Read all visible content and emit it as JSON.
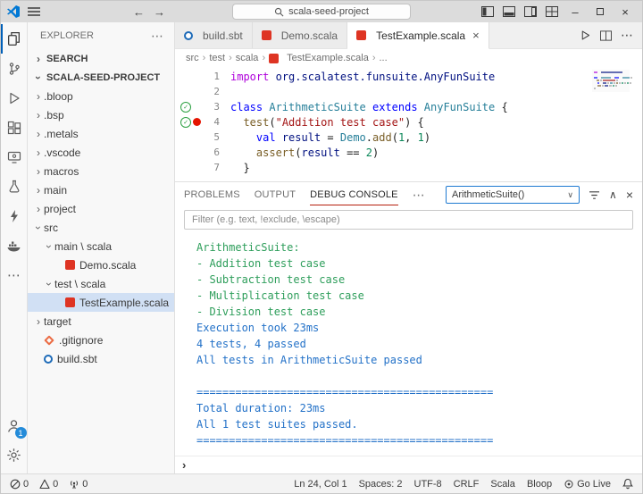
{
  "icons": {
    "more": "⋯",
    "close": "×",
    "check": "✓",
    "prompt": "›",
    "chevron": "›",
    "back": "←",
    "forward": "→",
    "chevron_down": "∨",
    "chevron_up": "∧",
    "minimize": "–"
  },
  "colors": {
    "accent_blue": "#005fb8",
    "console_green": "#2e9e5b",
    "console_blue": "#2472c8",
    "panel_active_underline": "#b5200d",
    "breakpoint_red": "#e51400",
    "test_pass_green": "#2da042",
    "scala_red": "#de3423",
    "keyword_purple": "#af00db",
    "keyword_blue": "#0000ff",
    "type_teal": "#267f99",
    "function_brown": "#795e26",
    "string_red": "#a31515",
    "number_green": "#098658"
  },
  "titlebar": {
    "search_value": "scala-seed-project"
  },
  "activity_bar": {
    "account_badge": "1"
  },
  "sidebar": {
    "header": "EXPLORER",
    "search_section": "SEARCH",
    "project_section": "SCALA-SEED-PROJECT",
    "tree": [
      {
        "label": ".bloop",
        "chevron": "right",
        "indent": 0
      },
      {
        "label": ".bsp",
        "chevron": "right",
        "indent": 0
      },
      {
        "label": ".metals",
        "chevron": "right",
        "indent": 0
      },
      {
        "label": ".vscode",
        "chevron": "right",
        "indent": 0
      },
      {
        "label": "macros",
        "chevron": "right",
        "indent": 0
      },
      {
        "label": "main",
        "chevron": "right",
        "indent": 0
      },
      {
        "label": "project",
        "chevron": "right",
        "indent": 0
      },
      {
        "label": "src",
        "chevron": "down",
        "indent": 0
      },
      {
        "label": "main \\ scala",
        "chevron": "down",
        "indent": 1
      },
      {
        "label": "Demo.scala",
        "icon": "scala",
        "indent": 2
      },
      {
        "label": "test \\ scala",
        "chevron": "down",
        "indent": 1
      },
      {
        "label": "TestExample.scala",
        "icon": "scala",
        "indent": 2,
        "selected": true
      },
      {
        "label": "target",
        "chevron": "right",
        "indent": 0
      },
      {
        "label": ".gitignore",
        "icon": "git",
        "indent": 0
      },
      {
        "label": "build.sbt",
        "icon": "sbt",
        "indent": 0
      }
    ]
  },
  "editor": {
    "tabs": [
      {
        "label": "build.sbt",
        "icon": "sbt"
      },
      {
        "label": "Demo.scala",
        "icon": "scala"
      },
      {
        "label": "TestExample.scala",
        "icon": "scala",
        "active": true
      }
    ],
    "breadcrumb": [
      "src",
      "test",
      "scala",
      "TestExample.scala",
      "..."
    ],
    "lines": [
      {
        "num": "1",
        "tokens": [
          {
            "t": "import",
            "c": "kw1"
          },
          {
            "t": " ",
            "c": "plain"
          },
          {
            "t": "org.scalatest.funsuite.AnyFunSuite",
            "c": "ns"
          }
        ]
      },
      {
        "num": "2",
        "tokens": []
      },
      {
        "num": "3",
        "check": true,
        "tokens": [
          {
            "t": "class",
            "c": "kw2"
          },
          {
            "t": " ",
            "c": "plain"
          },
          {
            "t": "ArithmeticSuite",
            "c": "type"
          },
          {
            "t": " ",
            "c": "plain"
          },
          {
            "t": "extends",
            "c": "kw2"
          },
          {
            "t": " ",
            "c": "plain"
          },
          {
            "t": "AnyFunSuite",
            "c": "type"
          },
          {
            "t": " {",
            "c": "plain"
          }
        ]
      },
      {
        "num": "4",
        "check": true,
        "bp": true,
        "tokens": [
          {
            "t": "  ",
            "c": "plain"
          },
          {
            "t": "test",
            "c": "func"
          },
          {
            "t": "(",
            "c": "plain"
          },
          {
            "t": "\"Addition test case\"",
            "c": "str"
          },
          {
            "t": ") {",
            "c": "plain"
          }
        ]
      },
      {
        "num": "5",
        "tokens": [
          {
            "t": "    ",
            "c": "plain"
          },
          {
            "t": "val",
            "c": "kw2"
          },
          {
            "t": " ",
            "c": "plain"
          },
          {
            "t": "result",
            "c": "ident"
          },
          {
            "t": " = ",
            "c": "plain"
          },
          {
            "t": "Demo",
            "c": "type"
          },
          {
            "t": ".",
            "c": "plain"
          },
          {
            "t": "add",
            "c": "func"
          },
          {
            "t": "(",
            "c": "plain"
          },
          {
            "t": "1",
            "c": "num"
          },
          {
            "t": ", ",
            "c": "plain"
          },
          {
            "t": "1",
            "c": "num"
          },
          {
            "t": ")",
            "c": "plain"
          }
        ]
      },
      {
        "num": "6",
        "tokens": [
          {
            "t": "    ",
            "c": "plain"
          },
          {
            "t": "assert",
            "c": "func"
          },
          {
            "t": "(",
            "c": "plain"
          },
          {
            "t": "result",
            "c": "ident"
          },
          {
            "t": " == ",
            "c": "plain"
          },
          {
            "t": "2",
            "c": "num"
          },
          {
            "t": ")",
            "c": "plain"
          }
        ]
      },
      {
        "num": "7",
        "tokens": [
          {
            "t": "  }",
            "c": "plain"
          }
        ]
      }
    ]
  },
  "panel": {
    "tabs": [
      {
        "label": "PROBLEMS"
      },
      {
        "label": "OUTPUT"
      },
      {
        "label": "DEBUG CONSOLE",
        "active": true
      }
    ],
    "dropdown_value": "ArithmeticSuite()",
    "filter_placeholder": "Filter (e.g. text, !exclude, \\escape)",
    "console_lines": [
      {
        "t": "ArithmeticSuite:",
        "c": "green"
      },
      {
        "t": "- Addition test case",
        "c": "green"
      },
      {
        "t": "- Subtraction test case",
        "c": "green"
      },
      {
        "t": "- Multiplication test case",
        "c": "green"
      },
      {
        "t": "- Division test case",
        "c": "green"
      },
      {
        "t": "Execution took 23ms",
        "c": "blue"
      },
      {
        "t": "4 tests, 4 passed",
        "c": "blue"
      },
      {
        "t": "All tests in ArithmeticSuite passed",
        "c": "blue"
      },
      {
        "t": "",
        "c": "blue"
      },
      {
        "t": "==============================================",
        "c": "blue"
      },
      {
        "t": "Total duration: 23ms",
        "c": "blue"
      },
      {
        "t": "All 1 test suites passed.",
        "c": "blue"
      },
      {
        "t": "==============================================",
        "c": "blue"
      }
    ],
    "prompt": "›"
  },
  "statusbar": {
    "left": [
      {
        "text": "0",
        "icon": "error"
      },
      {
        "text": "0",
        "icon": "warning"
      },
      {
        "text": "0",
        "icon": "radio-tower"
      }
    ],
    "right": [
      {
        "text": "Ln 24, Col 1"
      },
      {
        "text": "Spaces: 2"
      },
      {
        "text": "UTF-8"
      },
      {
        "text": "CRLF"
      },
      {
        "text": "Scala"
      },
      {
        "text": "Bloop"
      },
      {
        "text": "Go Live"
      }
    ]
  }
}
